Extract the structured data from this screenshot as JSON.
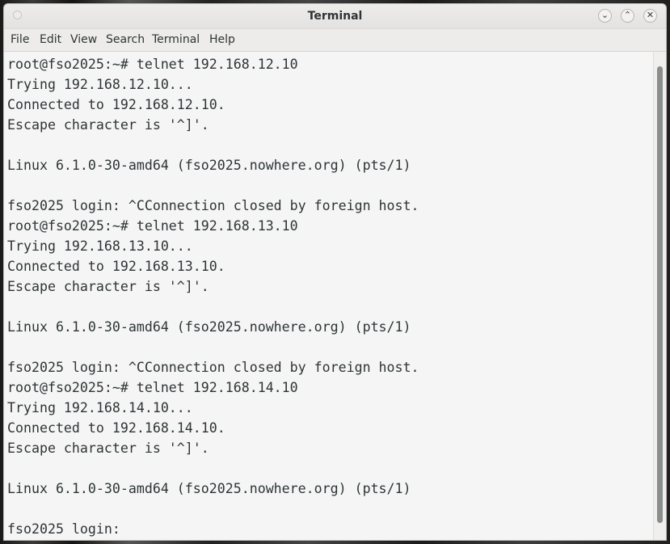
{
  "window": {
    "title": "Terminal",
    "buttons": {
      "minimize": "⌄",
      "maximize": "⌃",
      "close": "✕"
    }
  },
  "menu": [
    "File",
    "Edit",
    "View",
    "Search",
    "Terminal",
    "Help"
  ],
  "terminal": {
    "lines": [
      "root@fso2025:~# telnet 192.168.12.10",
      "Trying 192.168.12.10...",
      "Connected to 192.168.12.10.",
      "Escape character is '^]'.",
      "",
      "Linux 6.1.0-30-amd64 (fso2025.nowhere.org) (pts/1)",
      "",
      "fso2025 login: ^CConnection closed by foreign host.",
      "root@fso2025:~# telnet 192.168.13.10",
      "Trying 192.168.13.10...",
      "Connected to 192.168.13.10.",
      "Escape character is '^]'.",
      "",
      "Linux 6.1.0-30-amd64 (fso2025.nowhere.org) (pts/1)",
      "",
      "fso2025 login: ^CConnection closed by foreign host.",
      "root@fso2025:~# telnet 192.168.14.10",
      "Trying 192.168.14.10...",
      "Connected to 192.168.14.10.",
      "Escape character is '^]'.",
      "",
      "Linux 6.1.0-30-amd64 (fso2025.nowhere.org) (pts/1)",
      "",
      "fso2025 login: "
    ]
  },
  "colors": {
    "terminal_background": "#f5f5f5",
    "terminal_text": "#2e3436",
    "scrollbar_thumb": "#8b8e8f"
  }
}
